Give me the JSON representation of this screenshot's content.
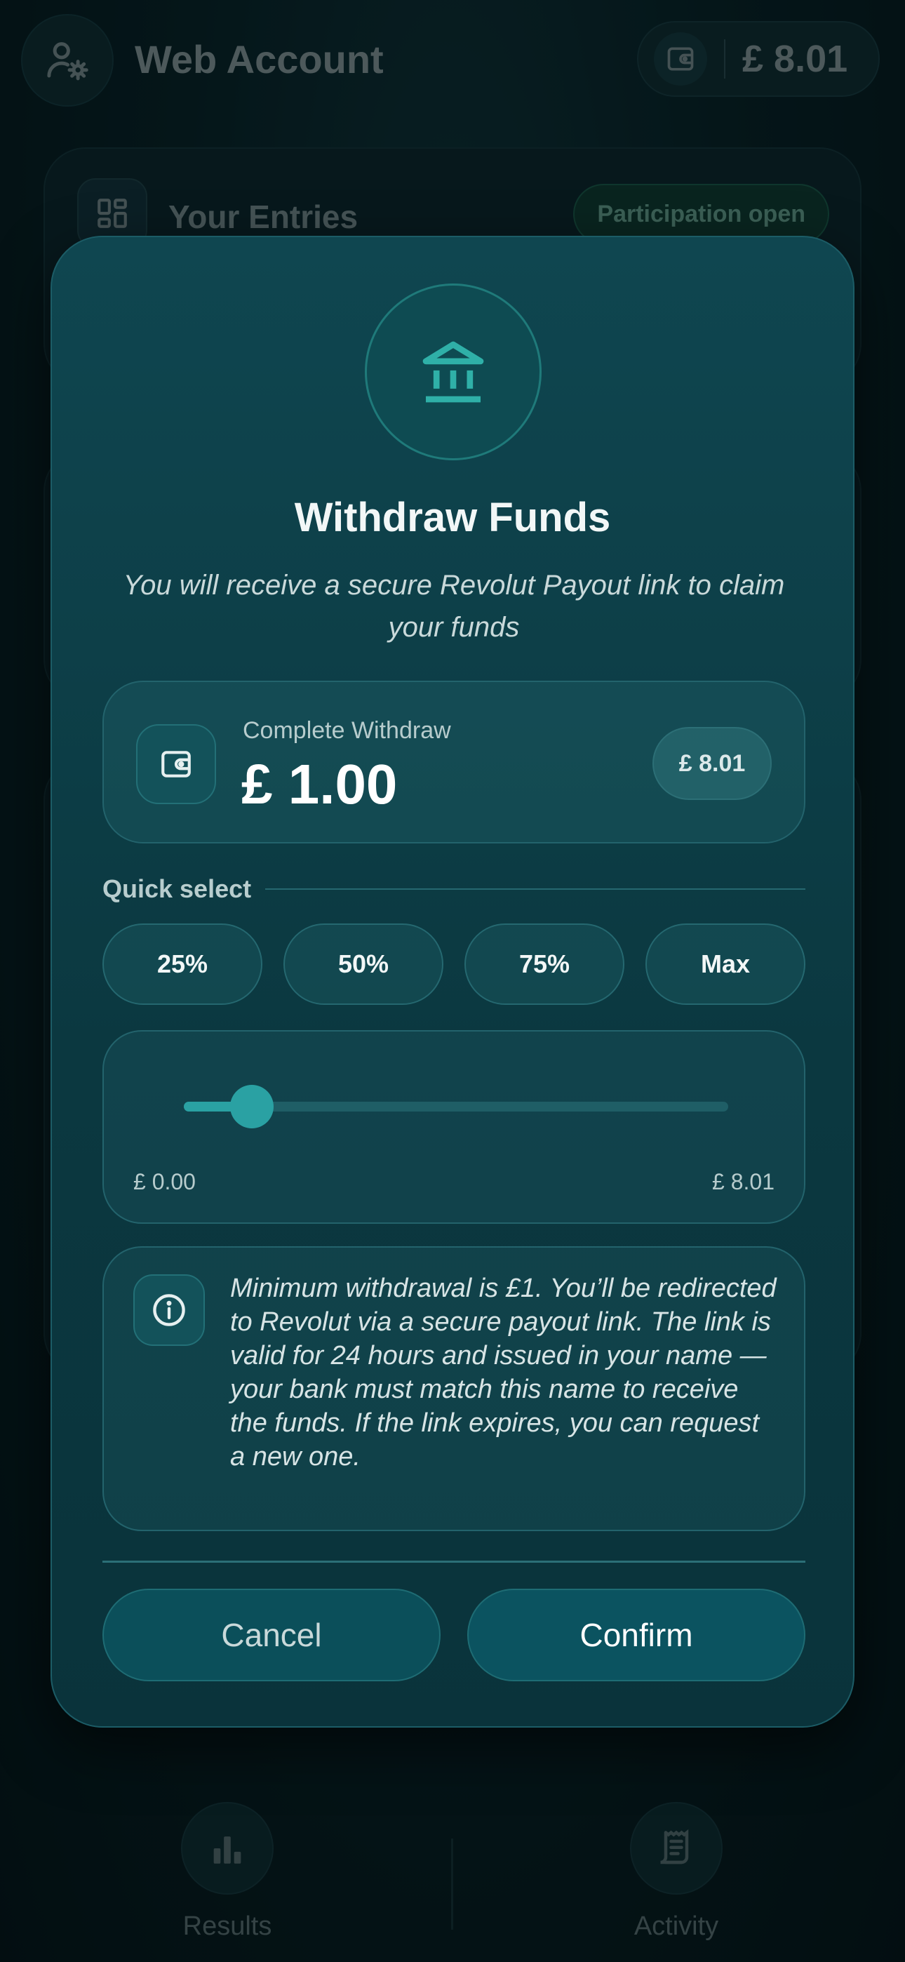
{
  "header": {
    "title": "Web Account",
    "balance": "£ 8.01"
  },
  "entries_card": {
    "title": "Your Entries",
    "status_badge": "Participation open"
  },
  "bottom_nav": {
    "items": [
      {
        "label": "Results",
        "icon": "bar-chart-icon"
      },
      {
        "label": "Activity",
        "icon": "receipt-icon"
      }
    ]
  },
  "modal": {
    "icon": "bank-icon",
    "title": "Withdraw Funds",
    "subtitle": "You will receive a secure Revolut Payout link to claim your funds",
    "amount": {
      "label": "Complete Withdraw",
      "value": "£ 1.00",
      "max_button": "£ 8.01"
    },
    "quick_select": {
      "label": "Quick select",
      "options": [
        "25%",
        "50%",
        "75%",
        "Max"
      ]
    },
    "slider": {
      "min_label": "£ 0.00",
      "max_label": "£ 8.01",
      "value_fraction": 0.125
    },
    "info": {
      "text": "Minimum withdrawal is £1. You’ll be redirected to Revolut via a secure payout link. The link is valid for 24 hours and issued in your name — your bank must match this name to receive the funds. If the link expires, you can request a new one."
    },
    "buttons": {
      "cancel": "Cancel",
      "confirm": "Confirm"
    }
  },
  "colors": {
    "accent": "#2aa1a3",
    "modal_background": "#0f4650",
    "status_green": "#6aa591"
  }
}
